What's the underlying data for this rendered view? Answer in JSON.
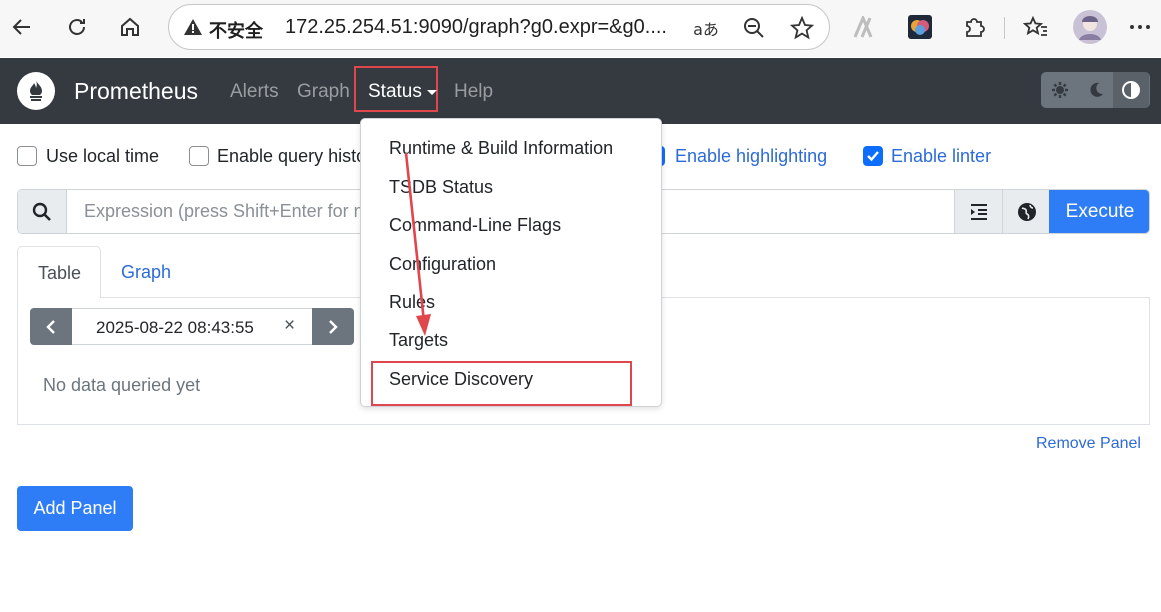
{
  "browser": {
    "security_label": "不安全",
    "url": "172.25.254.51:9090/graph?g0.expr=&g0....",
    "read_aloud_label": "aあ"
  },
  "navbar": {
    "brand": "Prometheus",
    "alerts": "Alerts",
    "graph": "Graph",
    "status": "Status",
    "help": "Help"
  },
  "options": {
    "local_time": "Use local time",
    "query_history": "Enable query history",
    "highlighting": "Enable highlighting",
    "linter": "Enable linter"
  },
  "expression": {
    "placeholder": "Expression (press Shift+Enter for newlines)",
    "execute": "Execute"
  },
  "tabs": {
    "table": "Table",
    "graph": "Graph"
  },
  "panel": {
    "datetime": "2025-08-22 08:43:55",
    "clear": "×",
    "no_data": "No data queried yet",
    "remove": "Remove Panel"
  },
  "add_panel": "Add Panel",
  "status_menu": [
    "Runtime & Build Information",
    "TSDB Status",
    "Command-Line Flags",
    "Configuration",
    "Rules",
    "Targets",
    "Service Discovery"
  ],
  "colors": {
    "navbar_bg": "#343a40",
    "accent_blue": "#2f7df6",
    "annotation_red": "#e0474c"
  }
}
